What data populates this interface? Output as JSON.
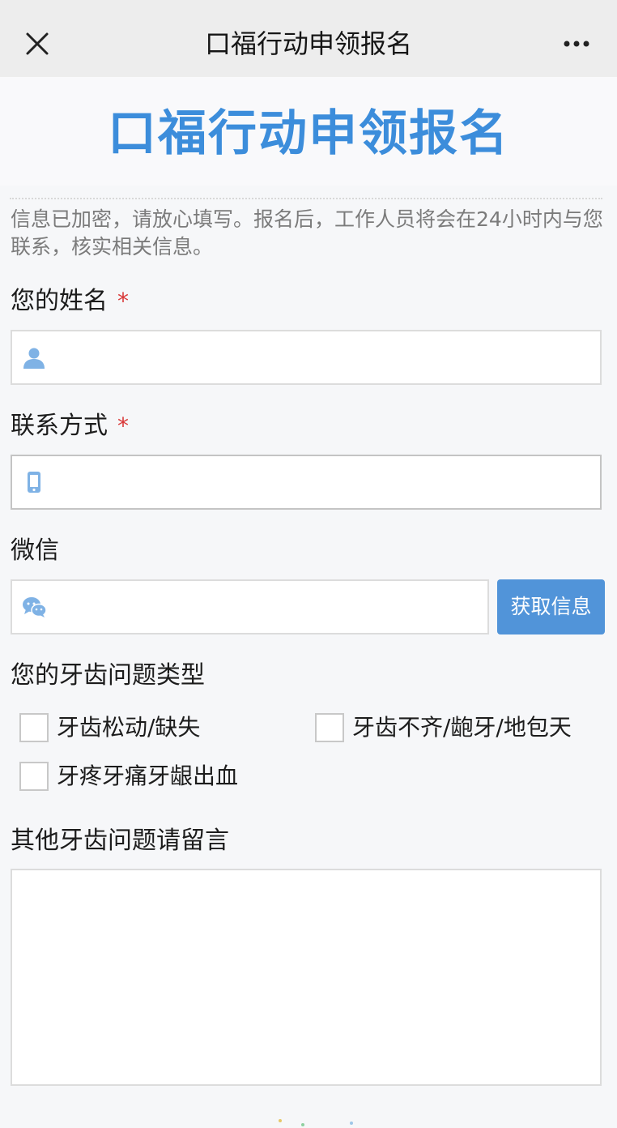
{
  "navbar": {
    "title": "口福行动申领报名"
  },
  "banner": {
    "title": "口福行动申领报名"
  },
  "notice": "信息已加密，请放心填写。报名后，工作人员将会在24小时内与您联系，核实相关信息。",
  "fields": {
    "name": {
      "label": "您的姓名",
      "required_mark": "*",
      "value": ""
    },
    "contact": {
      "label": "联系方式",
      "required_mark": "*",
      "value": ""
    },
    "wechat": {
      "label": "微信",
      "value": "",
      "button_label": "获取信息"
    }
  },
  "dental_problems": {
    "label": "您的牙齿问题类型",
    "options": [
      {
        "label": "牙齿松动/缺失",
        "checked": false
      },
      {
        "label": "牙齿不齐/龅牙/地包天",
        "checked": false
      },
      {
        "label": "牙疼牙痛牙龈出血",
        "checked": false
      }
    ]
  },
  "message": {
    "label": "其他牙齿问题请留言",
    "value": ""
  },
  "colors": {
    "accent": "#3c8ddb",
    "button": "#5194d9",
    "required": "#d93939",
    "icon": "#7fb2e5"
  },
  "icons": [
    "close-icon",
    "more-icon",
    "user-icon",
    "phone-icon",
    "wechat-icon"
  ]
}
